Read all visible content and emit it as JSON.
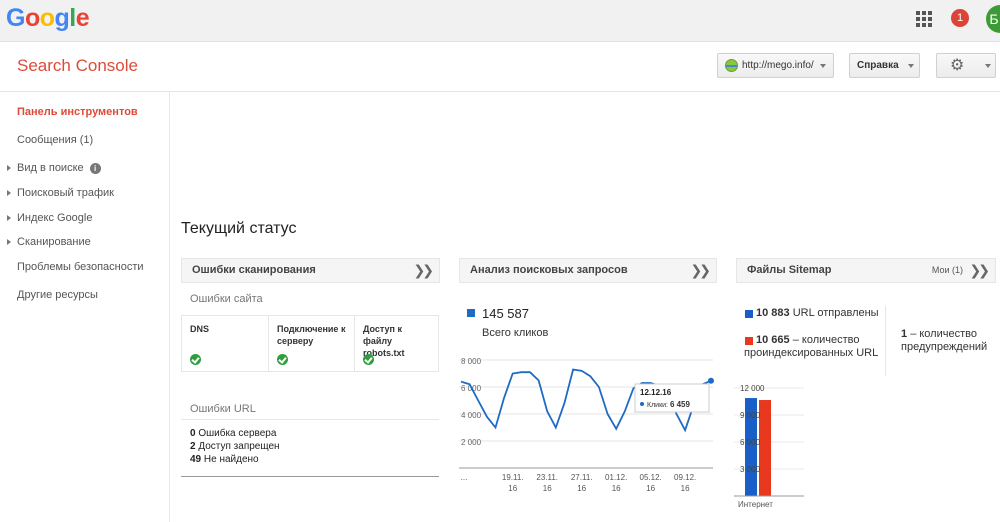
{
  "topbar": {
    "logo_letters": [
      {
        "ch": "G",
        "color": "#4285f4"
      },
      {
        "ch": "o",
        "color": "#ea4335"
      },
      {
        "ch": "o",
        "color": "#fbbc05"
      },
      {
        "ch": "g",
        "color": "#4285f4"
      },
      {
        "ch": "l",
        "color": "#34a853"
      },
      {
        "ch": "e",
        "color": "#ea4335"
      }
    ],
    "apps_icon": "apps-grid-icon",
    "notifications_count": "1",
    "avatar_letter": "Б"
  },
  "header": {
    "title": "Search Console",
    "site_selector": "http://mego.info/",
    "help_label": "Справка",
    "settings_icon": "gear-icon"
  },
  "sidebar": {
    "items": [
      {
        "label": "Панель инструментов",
        "active": true,
        "expandable": false
      },
      {
        "label": "Сообщения (1)",
        "active": false,
        "expandable": false
      },
      {
        "label": "Вид в поиске",
        "active": false,
        "expandable": true,
        "info": "i"
      },
      {
        "label": "Поисковый трафик",
        "active": false,
        "expandable": true
      },
      {
        "label": "Индекс Google",
        "active": false,
        "expandable": true
      },
      {
        "label": "Сканирование",
        "active": false,
        "expandable": true
      },
      {
        "label": "Проблемы безопасности",
        "active": false,
        "expandable": false
      },
      {
        "label": "Другие ресурсы",
        "active": false,
        "expandable": false
      }
    ]
  },
  "main": {
    "status_title": "Текущий статус",
    "crawl_errors": {
      "title": "Ошибки сканирования",
      "site_errors_label": "Ошибки сайта",
      "columns": [
        {
          "label": "DNS",
          "status": "ok"
        },
        {
          "label": "Подключение к серверу",
          "status": "ok"
        },
        {
          "label": "Доступ к файлу robots.txt",
          "status": "ok"
        }
      ],
      "url_errors_label": "Ошибки URL",
      "url_errors": [
        {
          "count": "0",
          "label": "Ошибка сервера"
        },
        {
          "count": "2",
          "label": "Доступ запрещен"
        },
        {
          "count": "49",
          "label": "Не найдено"
        }
      ]
    },
    "search_analytics": {
      "title": "Анализ поисковых запросов",
      "total_clicks": "145 587",
      "total_clicks_label": "Всего кликов",
      "tooltip_date": "12.12.16",
      "tooltip_label": "Клики:",
      "tooltip_value": "6 459"
    },
    "sitemaps": {
      "title": "Файлы Sitemap",
      "mine_label": "Мои (1)",
      "submitted_count": "10 883",
      "submitted_label": "URL отправлены",
      "indexed_count": "10 665",
      "indexed_label": "– количество проиндексированных URL",
      "warnings_count": "1",
      "warnings_label": "– количество предупреждений",
      "submitted_color": "#1a5fc7",
      "indexed_color": "#e8391f"
    }
  },
  "chart_data": [
    {
      "type": "line",
      "title": "",
      "xlabel": "",
      "ylabel": "",
      "ylim": [
        0,
        8000
      ],
      "yticks": [
        "8 000",
        "6 000",
        "4 000",
        "2 000"
      ],
      "xticks": [
        "...",
        "19.11.\n16",
        "23.11.\n16",
        "27.11.\n16",
        "01.12.\n16",
        "05.12.\n16",
        "09.12.\n16"
      ],
      "grid": true,
      "series": [
        {
          "color": "#1f6bc4",
          "x": [
            "13.11.16",
            "14.11.16",
            "15.11.16",
            "16.11.16",
            "17.11.16",
            "18.11.16",
            "19.11.16",
            "20.11.16",
            "21.11.16",
            "22.11.16",
            "23.11.16",
            "24.11.16",
            "25.11.16",
            "26.11.16",
            "27.11.16",
            "28.11.16",
            "29.11.16",
            "30.11.16",
            "01.12.16",
            "02.12.16",
            "03.12.16",
            "04.12.16",
            "05.12.16",
            "06.12.16",
            "07.12.16",
            "08.12.16",
            "09.12.16",
            "10.12.16",
            "11.12.16",
            "12.12.16"
          ],
          "values": [
            6400,
            6200,
            5000,
            3800,
            3000,
            5200,
            7000,
            7100,
            7100,
            6500,
            4200,
            3000,
            4800,
            7300,
            7200,
            6800,
            6000,
            4000,
            2900,
            4200,
            5900,
            6300,
            6300,
            6100,
            5500,
            4000,
            2800,
            4700,
            6200,
            6459
          ]
        }
      ]
    },
    {
      "type": "bar",
      "title": "",
      "categories": [
        "Интернет"
      ],
      "ylim": [
        0,
        12000
      ],
      "yticks": [
        "12 000",
        "9 000",
        "6 000",
        "3 000"
      ],
      "series": [
        {
          "color": "#1a5fc7",
          "values": [
            10883
          ]
        },
        {
          "color": "#e8391f",
          "values": [
            10665
          ]
        }
      ]
    }
  ]
}
